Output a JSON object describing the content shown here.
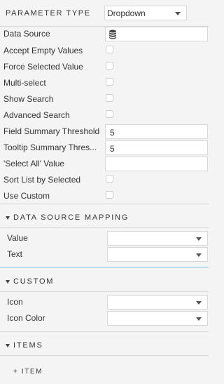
{
  "parameter_type": {
    "label": "PARAMETER TYPE",
    "value": "Dropdown"
  },
  "properties": {
    "data_source": "Data Source",
    "accept_empty_values": "Accept Empty Values",
    "force_selected_value": "Force Selected Value",
    "multi_select": "Multi-select",
    "show_search": "Show Search",
    "advanced_search": "Advanced Search",
    "field_summary_threshold": {
      "label": "Field Summary Threshold",
      "value": "5"
    },
    "tooltip_summary_threshold": {
      "label": "Tooltip Summary Thres...",
      "value": "5"
    },
    "select_all_value": {
      "label": "'Select All' Value",
      "value": ""
    },
    "sort_list_by_selected": "Sort List by Selected",
    "use_custom": "Use Custom"
  },
  "data_source_mapping": {
    "title": "DATA SOURCE MAPPING",
    "value_label": "Value",
    "text_label": "Text"
  },
  "custom": {
    "title": "CUSTOM",
    "icon_label": "Icon",
    "icon_color_label": "Icon Color"
  },
  "items": {
    "title": "ITEMS",
    "add_item_label": "+ ITEM"
  },
  "icons": {
    "data_source": "database-icon"
  },
  "colors": {
    "section_divider_accent": "#7cc4e0",
    "background": "#f4f4f4"
  }
}
